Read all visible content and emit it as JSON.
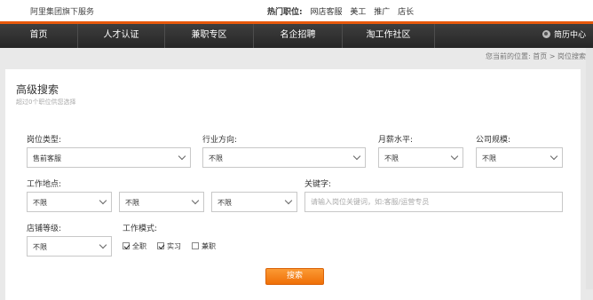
{
  "topbar": {
    "brand": "阿里集团旗下服务",
    "hot_label": "热门职位:",
    "hot_links": [
      "网店客服",
      "美工",
      "推广",
      "店长"
    ]
  },
  "nav": {
    "items": [
      "首页",
      "人才认证",
      "兼职专区",
      "名企招聘",
      "淘工作社区"
    ],
    "resume": "简历中心",
    "accent": "#e8590c"
  },
  "breadcrumb": {
    "prefix": "您当前的位置:",
    "home": "首页",
    "sep": ">",
    "current": "岗位搜索"
  },
  "panel": {
    "title": "高级搜索",
    "subtitle": "超过0个职位供您选择"
  },
  "form": {
    "job_type": {
      "label": "岗位类型:",
      "value": "售前客服"
    },
    "industry": {
      "label": "行业方向:",
      "value": "不限"
    },
    "salary": {
      "label": "月薪水平:",
      "value": "不限"
    },
    "company_size": {
      "label": "公司规模:",
      "value": "不限"
    },
    "location": {
      "label": "工作地点:",
      "values": [
        "不限",
        "不限",
        "不限"
      ]
    },
    "keyword": {
      "label": "关键字:",
      "placeholder": "请输入岗位关键词，如:客服/运营专员",
      "value": ""
    },
    "shop_level": {
      "label": "店铺等级:",
      "value": "不限"
    },
    "work_mode": {
      "label": "工作模式:",
      "options": [
        {
          "label": "全职",
          "checked": true
        },
        {
          "label": "实习",
          "checked": true
        },
        {
          "label": "兼职",
          "checked": false
        }
      ]
    },
    "search_button": "搜索",
    "button_color": "#ef6f07"
  }
}
